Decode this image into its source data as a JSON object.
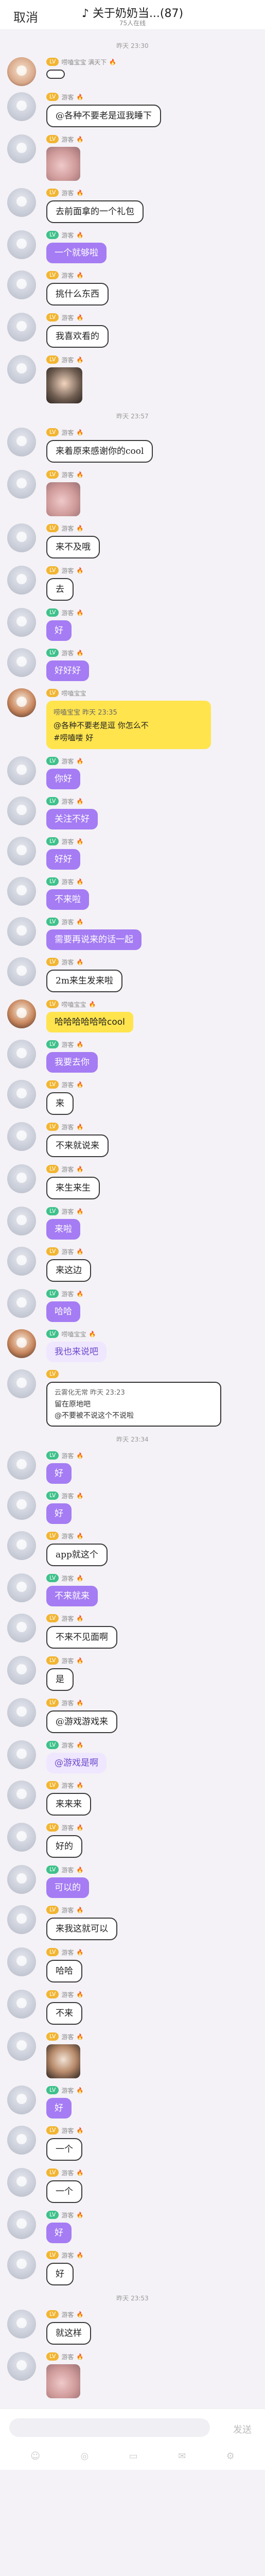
{
  "header": {
    "cancel": "取消",
    "title": "♪ 关于奶奶当...(87)",
    "subtitle": "75人在线"
  },
  "messages": [
    {
      "type": "time",
      "text": "昨天 23:30"
    },
    {
      "type": "text",
      "avatar": "pink",
      "level": "LV",
      "lv": "gold",
      "nick": "唠嗑宝宝 满天下",
      "fire": "🔥",
      "style": "b-white",
      "text": ""
    },
    {
      "type": "text",
      "avatar": "gray",
      "level": "LV",
      "lv": "gold",
      "nick": "游客",
      "fire": "🔥",
      "style": "b-white",
      "text": "@各种不要老是逗我睡下"
    },
    {
      "type": "image",
      "avatar": "gray",
      "level": "LV",
      "lv": "gold",
      "nick": "游客",
      "fire": "🔥",
      "img": "cat"
    },
    {
      "type": "text",
      "avatar": "gray",
      "level": "LV",
      "lv": "gold",
      "nick": "游客",
      "fire": "🔥",
      "style": "b-white",
      "text": "去前面拿的一个礼包"
    },
    {
      "type": "text",
      "avatar": "gray",
      "level": "LV",
      "lv": "green",
      "nick": "游客",
      "fire": "🔥",
      "style": "b-purple",
      "text": "一个就够啦"
    },
    {
      "type": "text",
      "avatar": "gray",
      "level": "LV",
      "lv": "gold",
      "nick": "游客",
      "fire": "🔥",
      "style": "b-white",
      "text": "挑什么东西"
    },
    {
      "type": "text",
      "avatar": "gray",
      "level": "LV",
      "lv": "gold",
      "nick": "游客",
      "fire": "🔥",
      "style": "b-white",
      "text": "我喜欢看的"
    },
    {
      "type": "image",
      "avatar": "gray",
      "level": "LV",
      "lv": "gold",
      "nick": "游客",
      "fire": "🔥",
      "img": "kid"
    },
    {
      "type": "time",
      "text": "昨天 23:57"
    },
    {
      "type": "text",
      "avatar": "gray",
      "level": "LV",
      "lv": "gold",
      "nick": "游客",
      "fire": "🔥",
      "style": "b-white",
      "text": "来着原来感谢你的cool"
    },
    {
      "type": "image",
      "avatar": "gray",
      "level": "LV",
      "lv": "gold",
      "nick": "游客",
      "fire": "🔥",
      "img": "cat"
    },
    {
      "type": "text",
      "avatar": "gray",
      "level": "LV",
      "lv": "gold",
      "nick": "游客",
      "fire": "🔥",
      "style": "b-white",
      "text": "来不及哦"
    },
    {
      "type": "text",
      "avatar": "gray",
      "level": "LV",
      "lv": "gold",
      "nick": "游客",
      "fire": "🔥",
      "style": "b-white",
      "text": "去"
    },
    {
      "type": "text",
      "avatar": "gray",
      "level": "LV",
      "lv": "green",
      "nick": "游客",
      "fire": "🔥",
      "style": "b-purple",
      "text": "好"
    },
    {
      "type": "text",
      "avatar": "gray",
      "level": "LV",
      "lv": "green",
      "nick": "游客",
      "fire": "🔥",
      "style": "b-purple",
      "text": "好好好"
    },
    {
      "type": "quote",
      "avatar": "girl",
      "level": "LV",
      "lv": "gold",
      "nick": "唠嗑宝宝",
      "fire": "",
      "quote": {
        "head": "唠嗑宝宝 昨天 23:35",
        "lines": [
          "@各种不要老是逗 你怎么不",
          "#唠嗑喽 好"
        ]
      }
    },
    {
      "type": "text",
      "avatar": "gray",
      "level": "LV",
      "lv": "green",
      "nick": "游客",
      "fire": "🔥",
      "style": "b-purple",
      "text": "你好"
    },
    {
      "type": "text",
      "avatar": "gray",
      "level": "LV",
      "lv": "green",
      "nick": "游客",
      "fire": "🔥",
      "style": "b-purple",
      "text": "关注不好"
    },
    {
      "type": "text",
      "avatar": "gray",
      "level": "LV",
      "lv": "green",
      "nick": "游客",
      "fire": "🔥",
      "style": "b-purple",
      "text": "好好"
    },
    {
      "type": "text",
      "avatar": "gray",
      "level": "LV",
      "lv": "green",
      "nick": "游客",
      "fire": "🔥",
      "style": "b-purple",
      "text": "不来啦"
    },
    {
      "type": "text",
      "avatar": "gray",
      "level": "LV",
      "lv": "green",
      "nick": "游客",
      "fire": "🔥",
      "style": "b-purple",
      "text": "需要再说来的话一起"
    },
    {
      "type": "text",
      "avatar": "gray",
      "level": "LV",
      "lv": "gold",
      "nick": "游客",
      "fire": "🔥",
      "style": "b-white",
      "text": "2m来生发来啦"
    },
    {
      "type": "text",
      "avatar": "girl",
      "level": "LV",
      "lv": "gold",
      "nick": "唠嗑宝宝",
      "fire": "🔥",
      "style": "b-yellow",
      "text": "哈哈哈哈哈哈cool"
    },
    {
      "type": "text",
      "avatar": "gray",
      "level": "LV",
      "lv": "green",
      "nick": "游客",
      "fire": "🔥",
      "style": "b-purple",
      "text": "我要去你"
    },
    {
      "type": "text",
      "avatar": "gray",
      "level": "LV",
      "lv": "gold",
      "nick": "游客",
      "fire": "🔥",
      "style": "b-white",
      "text": "来"
    },
    {
      "type": "text",
      "avatar": "gray",
      "level": "LV",
      "lv": "gold",
      "nick": "游客",
      "fire": "🔥",
      "style": "b-white",
      "text": "不来就说来"
    },
    {
      "type": "text",
      "avatar": "gray",
      "level": "LV",
      "lv": "gold",
      "nick": "游客",
      "fire": "🔥",
      "style": "b-white",
      "text": "来生来生"
    },
    {
      "type": "text",
      "avatar": "gray",
      "level": "LV",
      "lv": "green",
      "nick": "游客",
      "fire": "🔥",
      "style": "b-purple",
      "text": "来啦"
    },
    {
      "type": "text",
      "avatar": "gray",
      "level": "LV",
      "lv": "gold",
      "nick": "游客",
      "fire": "🔥",
      "style": "b-white",
      "text": "来这边"
    },
    {
      "type": "text",
      "avatar": "gray",
      "level": "LV",
      "lv": "green",
      "nick": "游客",
      "fire": "🔥",
      "style": "b-purple",
      "text": "哈哈"
    },
    {
      "type": "text",
      "avatar": "girl",
      "level": "LV",
      "lv": "green",
      "nick": "唠嗑宝宝",
      "fire": "🔥",
      "style": "b-lilac",
      "text": "我也来说吧"
    },
    {
      "type": "quote",
      "avatar": "gray",
      "level": "LV",
      "lv": "gold",
      "nick": "",
      "fire": "",
      "quote": {
        "head": "云雾化无常 昨天 23:23",
        "lines": [
          "留在原地吧",
          "@不要被不说这个不说啦"
        ]
      }
    },
    {
      "type": "time",
      "text": "昨天 23:34"
    },
    {
      "type": "text",
      "avatar": "gray",
      "level": "LV",
      "lv": "green",
      "nick": "游客",
      "fire": "🔥",
      "style": "b-purple",
      "text": "好"
    },
    {
      "type": "text",
      "avatar": "gray",
      "level": "LV",
      "lv": "green",
      "nick": "游客",
      "fire": "🔥",
      "style": "b-purple",
      "text": "好"
    },
    {
      "type": "text",
      "avatar": "gray",
      "level": "LV",
      "lv": "gold",
      "nick": "游客",
      "fire": "🔥",
      "style": "b-white",
      "text": "app就这个"
    },
    {
      "type": "text",
      "avatar": "gray",
      "level": "LV",
      "lv": "green",
      "nick": "游客",
      "fire": "🔥",
      "style": "b-purple",
      "text": "不来就来"
    },
    {
      "type": "text",
      "avatar": "gray",
      "level": "LV",
      "lv": "gold",
      "nick": "游客",
      "fire": "🔥",
      "style": "b-white",
      "text": "不来不见面啊"
    },
    {
      "type": "text",
      "avatar": "gray",
      "level": "LV",
      "lv": "gold",
      "nick": "游客",
      "fire": "🔥",
      "style": "b-white",
      "text": "是"
    },
    {
      "type": "text",
      "avatar": "gray",
      "level": "LV",
      "lv": "gold",
      "nick": "游客",
      "fire": "🔥",
      "style": "b-white",
      "text": "@游戏游戏来"
    },
    {
      "type": "text",
      "avatar": "gray",
      "level": "LV",
      "lv": "green",
      "nick": "游客",
      "fire": "🔥",
      "style": "b-lilac",
      "text": "@游戏是啊"
    },
    {
      "type": "text",
      "avatar": "gray",
      "level": "LV",
      "lv": "gold",
      "nick": "游客",
      "fire": "🔥",
      "style": "b-white",
      "text": "来来来"
    },
    {
      "type": "text",
      "avatar": "gray",
      "level": "LV",
      "lv": "gold",
      "nick": "游客",
      "fire": "🔥",
      "style": "b-white",
      "text": "好的"
    },
    {
      "type": "text",
      "avatar": "gray",
      "level": "LV",
      "lv": "green",
      "nick": "游客",
      "fire": "🔥",
      "style": "b-purple",
      "text": "可以的"
    },
    {
      "type": "text",
      "avatar": "gray",
      "level": "LV",
      "lv": "gold",
      "nick": "游客",
      "fire": "🔥",
      "style": "b-white",
      "text": "来我这就可以"
    },
    {
      "type": "text",
      "avatar": "gray",
      "level": "LV",
      "lv": "gold",
      "nick": "游客",
      "fire": "🔥",
      "style": "b-white",
      "text": "哈哈"
    },
    {
      "type": "text",
      "avatar": "gray",
      "level": "LV",
      "lv": "gold",
      "nick": "游客",
      "fire": "🔥",
      "style": "b-white",
      "text": "不来"
    },
    {
      "type": "image",
      "avatar": "gray",
      "level": "LV",
      "lv": "gold",
      "nick": "游客",
      "fire": "🔥",
      "img": "girl"
    },
    {
      "type": "text",
      "avatar": "gray",
      "level": "LV",
      "lv": "green",
      "nick": "游客",
      "fire": "🔥",
      "style": "b-purple",
      "text": "好"
    },
    {
      "type": "text",
      "avatar": "gray",
      "level": "LV",
      "lv": "gold",
      "nick": "游客",
      "fire": "🔥",
      "style": "b-white",
      "text": "一个"
    },
    {
      "type": "text",
      "avatar": "gray",
      "level": "LV",
      "lv": "gold",
      "nick": "游客",
      "fire": "🔥",
      "style": "b-white",
      "text": "一个"
    },
    {
      "type": "text",
      "avatar": "gray",
      "level": "LV",
      "lv": "green",
      "nick": "游客",
      "fire": "🔥",
      "style": "b-purple",
      "text": "好"
    },
    {
      "type": "text",
      "avatar": "gray",
      "level": "LV",
      "lv": "gold",
      "nick": "游客",
      "fire": "🔥",
      "style": "b-white",
      "text": "好"
    },
    {
      "type": "time",
      "text": "昨天 23:53"
    },
    {
      "type": "text",
      "avatar": "gray",
      "level": "LV",
      "lv": "gold",
      "nick": "游客",
      "fire": "🔥",
      "style": "b-white",
      "text": "就这样"
    },
    {
      "type": "image",
      "avatar": "gray",
      "level": "LV",
      "lv": "gold",
      "nick": "游客",
      "fire": "🔥",
      "img": "cat"
    }
  ],
  "input": {
    "placeholder": "",
    "send": "发送"
  },
  "bottom_icons": [
    "☺",
    "◎",
    "▭",
    "✉",
    "⚙"
  ]
}
